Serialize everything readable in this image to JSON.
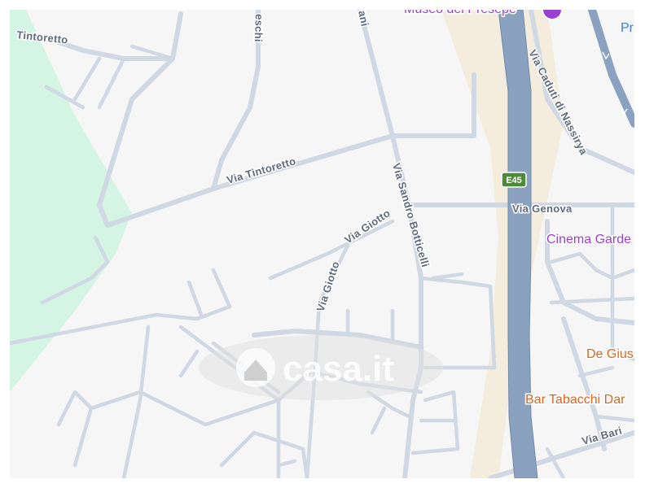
{
  "map": {
    "streets": {
      "tintoretto_top": "Tintoretto",
      "tintoretto": "Via Tintoretto",
      "veronese_partial": "eschi",
      "raffaello_partial": "ani",
      "botticelli": "Via Sandro Botticelli",
      "giotto_1": "Via Giotto",
      "giotto_2": "Via Giotto",
      "caduti": "Via Caduti di Nassirya",
      "genova": "Via Genova",
      "bari": "Via Bari"
    },
    "highway": {
      "shield": "E45"
    },
    "pois": {
      "museo": "Museo del Presepe",
      "cinema": "Cinema Garde",
      "degius": "De Gius",
      "bar": "Bar Tabacchi Dar",
      "pr": "Pr"
    },
    "watermark": {
      "text": "casa.it",
      "icon": "house-icon"
    },
    "colors": {
      "background": "#f6f6f6",
      "park": "#d4f5e3",
      "road": "#cfd8e3",
      "highway": "#8aa2c0",
      "highway_band": "#f4ecdc",
      "poi_purple": "#9a3fd0",
      "poi_orange": "#d9661e",
      "highway_shield": "#4f8a3a"
    }
  }
}
